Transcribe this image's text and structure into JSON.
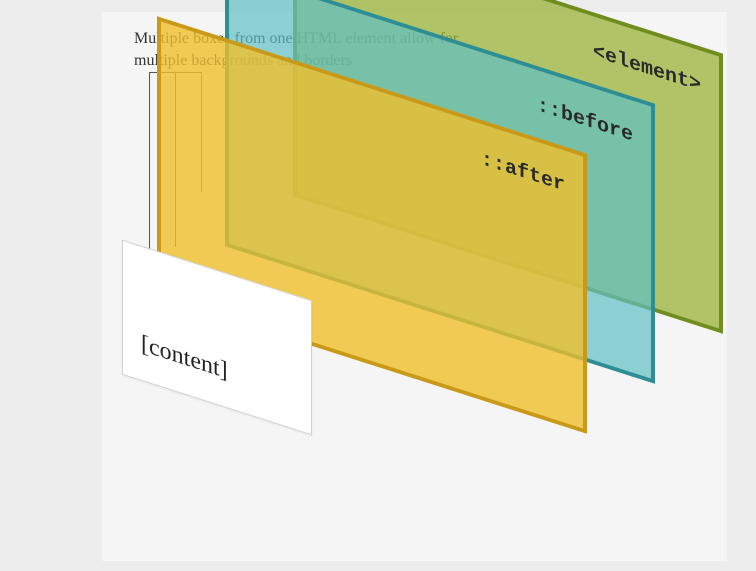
{
  "caption": "Multiple boxes from one HTML element allow for multiple backgrounds and  borders",
  "layers": {
    "element": {
      "label": "<element>",
      "fill": "rgba(149,178,49,0.72)",
      "border": "#718c1f"
    },
    "before": {
      "label": "::before",
      "fill": "rgba(95,193,198,0.70)",
      "border": "#2f8e94"
    },
    "after": {
      "label": "::after",
      "fill": "rgba(239,191,42,0.80)",
      "border": "#c99a1a"
    },
    "content": {
      "label": "[content]",
      "fill": "#ffffff",
      "border": "#d0d0d0"
    }
  },
  "order_back_to_front": [
    "element",
    "before",
    "after",
    "content"
  ]
}
